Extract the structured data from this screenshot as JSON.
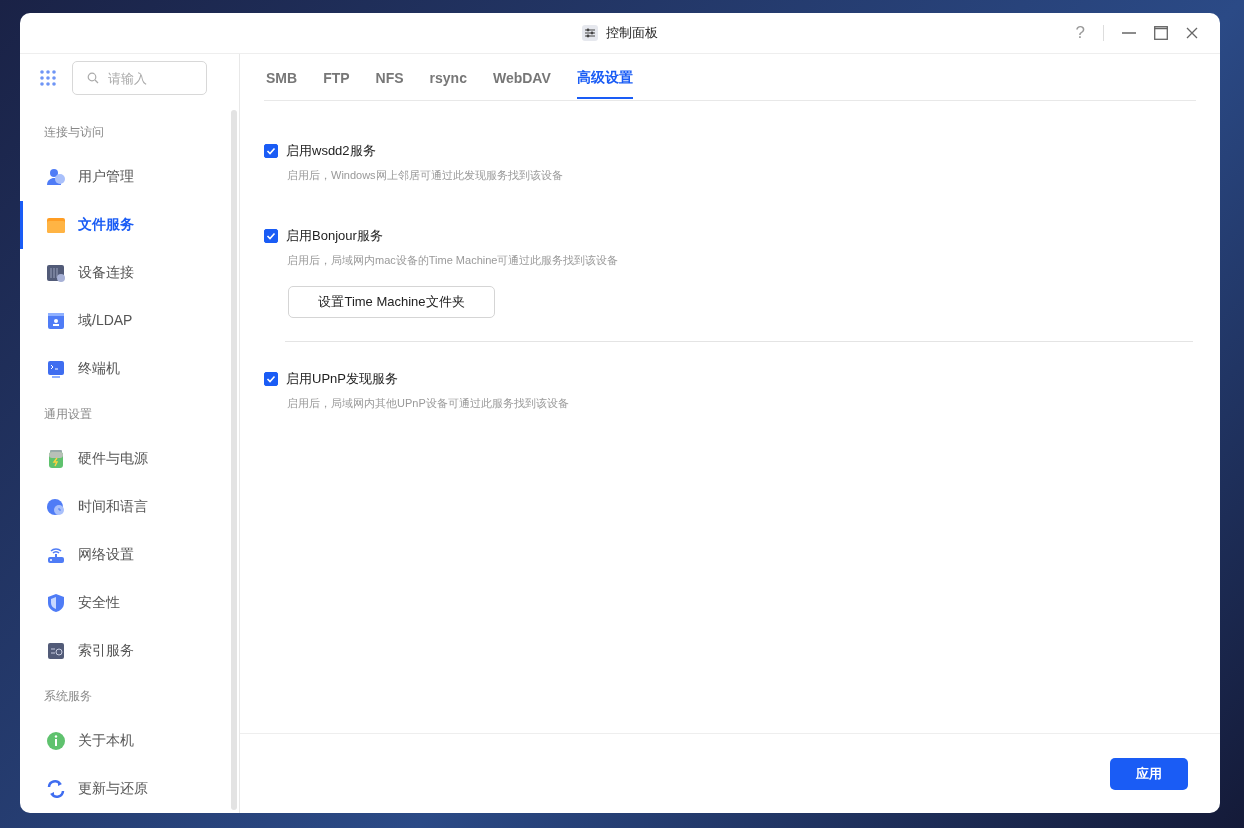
{
  "window": {
    "title": "控制面板",
    "help": "?"
  },
  "sidebar": {
    "search": {
      "placeholder": "请输入"
    },
    "groups": [
      {
        "header": "连接与访问",
        "items": [
          {
            "label": "用户管理",
            "selected": false
          },
          {
            "label": "文件服务",
            "selected": true
          },
          {
            "label": "设备连接",
            "selected": false
          },
          {
            "label": "域/LDAP",
            "selected": false
          },
          {
            "label": "终端机",
            "selected": false
          }
        ]
      },
      {
        "header": "通用设置",
        "items": [
          {
            "label": "硬件与电源",
            "selected": false
          },
          {
            "label": "时间和语言",
            "selected": false
          },
          {
            "label": "网络设置",
            "selected": false
          },
          {
            "label": "安全性",
            "selected": false
          },
          {
            "label": "索引服务",
            "selected": false
          }
        ]
      },
      {
        "header": "系统服务",
        "items": [
          {
            "label": "关于本机",
            "selected": false
          },
          {
            "label": "更新与还原",
            "selected": false
          }
        ]
      }
    ]
  },
  "tabs": [
    {
      "label": "SMB",
      "selected": false
    },
    {
      "label": "FTP",
      "selected": false
    },
    {
      "label": "NFS",
      "selected": false
    },
    {
      "label": "rsync",
      "selected": false
    },
    {
      "label": "WebDAV",
      "selected": false
    },
    {
      "label": "高级设置",
      "selected": true
    }
  ],
  "settings": [
    {
      "label": "启用wsdd2服务",
      "checked": true,
      "description": "启用后，Windows网上邻居可通过此发现服务找到该设备"
    },
    {
      "label": "启用Bonjour服务",
      "checked": true,
      "description": "启用后，局域网内mac设备的Time Machine可通过此服务找到该设备",
      "button": "设置Time Machine文件夹"
    },
    {
      "label": "启用UPnP发现服务",
      "checked": true,
      "description": "启用后，局域网内其他UPnP设备可通过此服务找到该设备"
    }
  ],
  "footer": {
    "apply_button": "应用"
  }
}
